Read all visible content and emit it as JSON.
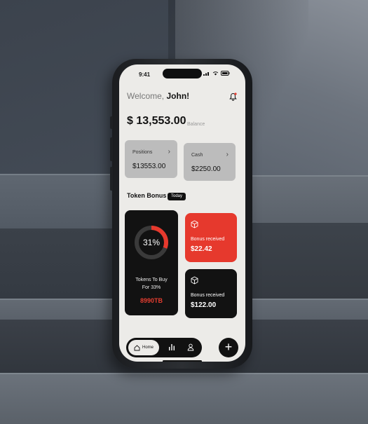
{
  "status_bar": {
    "time": "9:41"
  },
  "header": {
    "welcome_prefix": "Welcome,",
    "user_name": "John!"
  },
  "balance": {
    "amount": "$ 13,553.00",
    "label": "Balance"
  },
  "cards": [
    {
      "label": "Positions",
      "value": "$13553.00"
    },
    {
      "label": "Cash",
      "value": "$2250.00"
    }
  ],
  "token_bonus": {
    "title": "Token Bonus",
    "badge": "Today",
    "progress_percent": 31,
    "progress_label": "31%",
    "tokens_label_line1": "Tokens To Buy",
    "tokens_label_line2": "For 33%",
    "tokens_value": "8990TB",
    "bonus_cards": [
      {
        "label": "Bonus received",
        "value": "$22.42"
      },
      {
        "label": "Bonus received",
        "value": "$122.00"
      }
    ]
  },
  "nav": {
    "home_label": "Home",
    "fab_symbol": "+"
  },
  "colors": {
    "accent_red": "#e6392d",
    "dark": "#121212",
    "screen_bg": "#ecebe8",
    "card_gray": "#bcbcbc"
  },
  "icons": [
    "bell-icon",
    "cube-icon",
    "home-icon",
    "bar-chart-icon",
    "user-icon",
    "plus-icon",
    "wifi-icon",
    "signal-icon",
    "battery-icon",
    "chevron-right-icon"
  ]
}
